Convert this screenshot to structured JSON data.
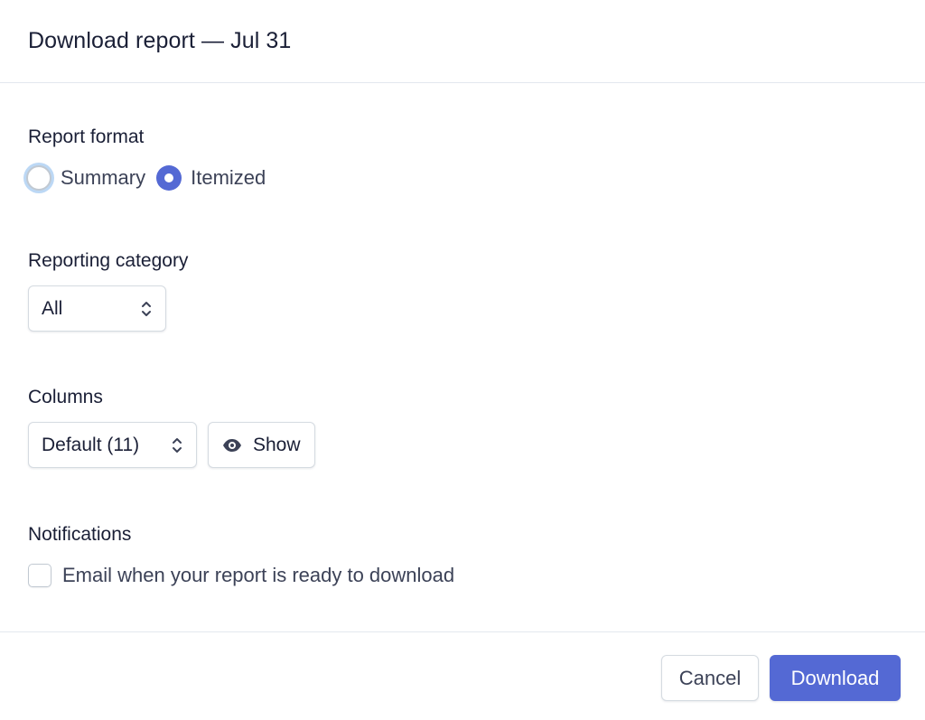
{
  "dialog": {
    "title": "Download report — Jul 31"
  },
  "report_format": {
    "label": "Report format",
    "options": [
      {
        "label": "Summary",
        "checked": false
      },
      {
        "label": "Itemized",
        "checked": true
      }
    ]
  },
  "reporting_category": {
    "label": "Reporting category",
    "selected": "All"
  },
  "columns": {
    "label": "Columns",
    "selected": "Default (11)",
    "show_label": "Show"
  },
  "notifications": {
    "label": "Notifications",
    "email_label": "Email when your report is ready to download",
    "email_checked": false
  },
  "footer": {
    "cancel_label": "Cancel",
    "download_label": "Download"
  },
  "colors": {
    "accent": "#5469d4",
    "focus_ring": "#bcd8f5",
    "border": "#d5dbe1",
    "text": "#1a1f36"
  },
  "icons": {
    "select_chevron": "chevron-up-down-icon",
    "show": "eye-icon"
  }
}
